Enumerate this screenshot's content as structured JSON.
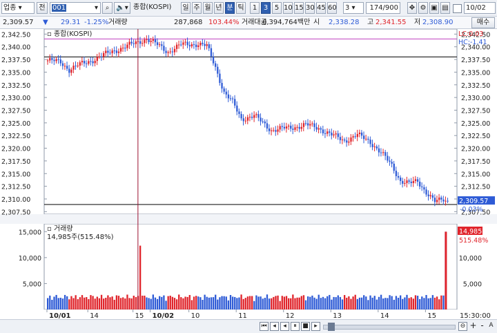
{
  "toolbar": {
    "category": "업종",
    "jeon_label": "전",
    "code_value": "001",
    "speaker_icon": "speaker-icon",
    "index_name": "종합(KOSPI)",
    "period_buttons": [
      "일",
      "주",
      "월",
      "년",
      "분",
      "틱"
    ],
    "active_period": "분",
    "interval_buttons": [
      "1",
      "3",
      "5",
      "10",
      "15",
      "30",
      "45",
      "60"
    ],
    "active_interval": "3",
    "interval_select": "3",
    "count_display": "174/900",
    "date_value": "10/02"
  },
  "quote": {
    "price": "2,309.57",
    "change": "29.31",
    "change_pct": "-1.25%",
    "volume_label": "거래량",
    "volume": "287,868",
    "volume_ratio": "103.44%",
    "amount_label": "거래대금",
    "amount": "6,394,764백만",
    "open_label": "시",
    "open": "2,338.28",
    "high_label": "고",
    "high": "2,341.55",
    "low_label": "저",
    "low": "2,308.90",
    "buy_label": "매수"
  },
  "colors": {
    "up": "#e0242b",
    "down": "#2e5bd6",
    "crosshair": "#9b1030",
    "limit_line": "#c040c0",
    "price_tag": "#2e5bd6"
  },
  "chart_data": [
    {
      "type": "candlestick",
      "title": "종합(KOSPI)",
      "lc_label": "LC:0.03",
      "hc_label": "HC:-1.41",
      "y_ticks": [
        "2,342.50",
        "2,340.00",
        "2,337.50",
        "2,335.00",
        "2,332.50",
        "2,330.00",
        "2,327.50",
        "2,325.00",
        "2,322.50",
        "2,320.00",
        "2,317.50",
        "2,315.00",
        "2,312.50",
        "2,310.00",
        "2,307.50"
      ],
      "ylim": [
        2307.0,
        2343.5
      ],
      "current_price_tag": "2,309.57",
      "current_change_tag": "-0.03%",
      "reference_lines": [
        2341.55,
        2338.0,
        2308.9
      ],
      "x_ticks": [
        "10/01",
        "14",
        "15",
        "10/02",
        "10",
        "11",
        "12",
        "13",
        "14",
        "15"
      ],
      "trend_points": [
        [
          0,
          2337.3
        ],
        [
          6,
          2337.0
        ],
        [
          10,
          2335.5
        ],
        [
          14,
          2336.3
        ],
        [
          22,
          2337.6
        ],
        [
          30,
          2339.1
        ],
        [
          40,
          2340.6
        ],
        [
          46,
          2341.6
        ],
        [
          52,
          2340.1
        ],
        [
          56,
          2339.0
        ],
        [
          62,
          2340.4
        ],
        [
          70,
          2340.6
        ],
        [
          74,
          2340.1
        ],
        [
          78,
          2336.0
        ],
        [
          82,
          2331.0
        ],
        [
          86,
          2329.0
        ],
        [
          90,
          2325.8
        ],
        [
          96,
          2326.4
        ],
        [
          104,
          2323.6
        ],
        [
          112,
          2324.0
        ],
        [
          120,
          2324.6
        ],
        [
          126,
          2324.0
        ],
        [
          132,
          2322.6
        ],
        [
          138,
          2321.5
        ],
        [
          144,
          2322.6
        ],
        [
          150,
          2321.3
        ],
        [
          156,
          2318.6
        ],
        [
          160,
          2316.6
        ],
        [
          164,
          2313.6
        ],
        [
          168,
          2313.0
        ],
        [
          172,
          2313.5
        ],
        [
          176,
          2311.4
        ],
        [
          180,
          2309.4
        ],
        [
          184,
          2309.9
        ],
        [
          186,
          2309.57
        ]
      ]
    },
    {
      "type": "bar",
      "title": "거래량",
      "readout": "14,985주(515.48%)",
      "value_tag": "14,985",
      "ratio_tag": "515.48%",
      "y_ticks": [
        "15,000",
        "10,000",
        "5,000"
      ],
      "ylim": [
        0,
        16500
      ],
      "spikes": [
        {
          "index": 43,
          "value": 12300
        },
        {
          "index": 185,
          "value": 14985
        }
      ],
      "base_range": [
        1500,
        2900
      ]
    }
  ],
  "bottom": {
    "time_label": "15:30:00",
    "plus": "+",
    "minus": "-",
    "a_label": "A"
  }
}
